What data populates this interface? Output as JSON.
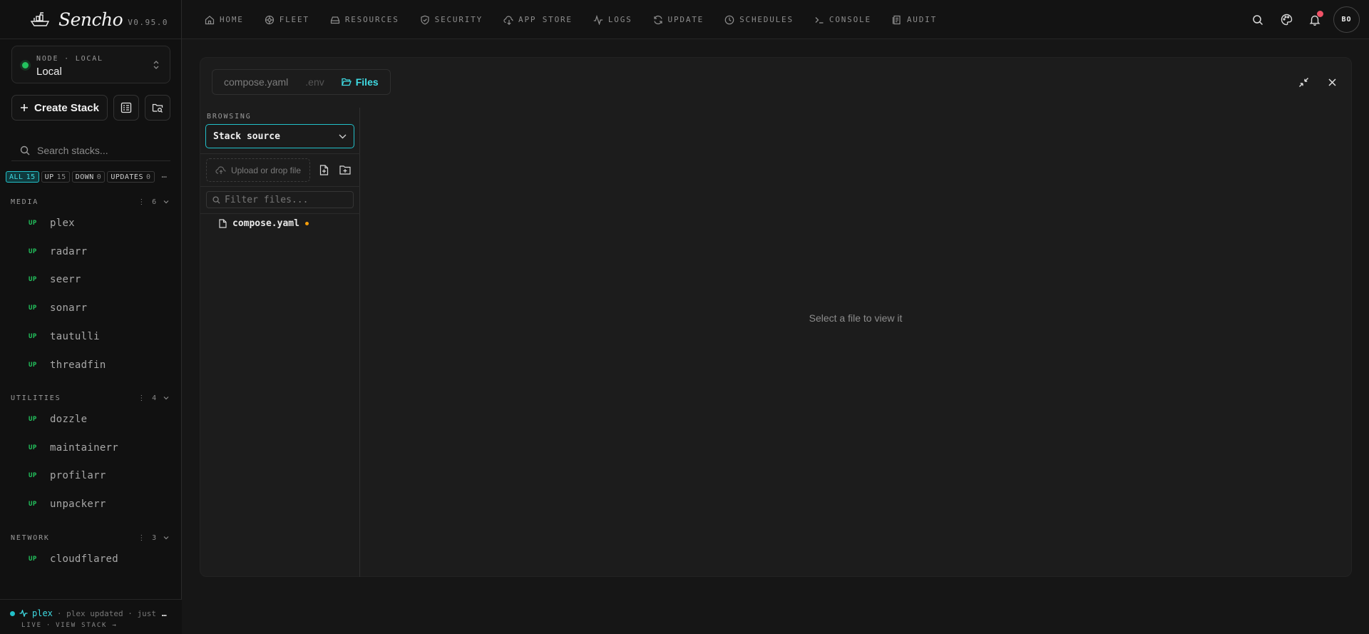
{
  "brand": {
    "name": "Sencho",
    "version": "V0.95.0"
  },
  "node": {
    "kicker": "NODE · LOCAL",
    "value": "Local"
  },
  "actions": {
    "create_label": "Create Stack"
  },
  "search": {
    "placeholder": "Search stacks..."
  },
  "filters": [
    {
      "label": "ALL",
      "count": "15",
      "active": true
    },
    {
      "label": "UP",
      "count": "15",
      "active": false
    },
    {
      "label": "DOWN",
      "count": "0",
      "active": false
    },
    {
      "label": "UPDATES",
      "count": "0",
      "active": false
    }
  ],
  "groups": [
    {
      "name": "MEDIA",
      "count": "6",
      "items": [
        {
          "status": "UP",
          "name": "plex"
        },
        {
          "status": "UP",
          "name": "radarr"
        },
        {
          "status": "UP",
          "name": "seerr"
        },
        {
          "status": "UP",
          "name": "sonarr"
        },
        {
          "status": "UP",
          "name": "tautulli"
        },
        {
          "status": "UP",
          "name": "threadfin"
        }
      ]
    },
    {
      "name": "UTILITIES",
      "count": "4",
      "items": [
        {
          "status": "UP",
          "name": "dozzle"
        },
        {
          "status": "UP",
          "name": "maintainerr"
        },
        {
          "status": "UP",
          "name": "profilarr"
        },
        {
          "status": "UP",
          "name": "unpackerr"
        }
      ]
    },
    {
      "name": "NETWORK",
      "count": "3",
      "items": [
        {
          "status": "UP",
          "name": "cloudflared"
        }
      ]
    }
  ],
  "activity": {
    "stack": "plex",
    "message": "· plex updated · just",
    "ellipsis": "…",
    "live": "LIVE",
    "sep": "·",
    "view": "VIEW STACK →"
  },
  "nav": [
    {
      "label": "HOME",
      "icon": "home-icon"
    },
    {
      "label": "FLEET",
      "icon": "fleet-icon"
    },
    {
      "label": "RESOURCES",
      "icon": "resources-icon"
    },
    {
      "label": "SECURITY",
      "icon": "shield-icon"
    },
    {
      "label": "APP STORE",
      "icon": "app-store-icon"
    },
    {
      "label": "LOGS",
      "icon": "logs-icon"
    },
    {
      "label": "UPDATE",
      "icon": "refresh-icon"
    },
    {
      "label": "SCHEDULES",
      "icon": "clock-icon"
    },
    {
      "label": "CONSOLE",
      "icon": "terminal-icon"
    },
    {
      "label": "AUDIT",
      "icon": "audit-icon"
    }
  ],
  "user": {
    "initials": "BO"
  },
  "editor": {
    "tabs": [
      {
        "label": "compose.yaml",
        "state": "normal"
      },
      {
        "label": ".env",
        "state": "dim"
      },
      {
        "label": "Files",
        "state": "active"
      }
    ],
    "browsing_label": "BROWSING",
    "source_value": "Stack source",
    "upload_label": "Upload or drop file",
    "filter_placeholder": "Filter files...",
    "files": [
      {
        "name": "compose.yaml",
        "modified": true
      }
    ],
    "empty_message": "Select a file to view it"
  },
  "colors": {
    "accent": "#22c0c9",
    "up": "#23c55e",
    "badge": "#f05267",
    "modified": "#f59e0b"
  }
}
